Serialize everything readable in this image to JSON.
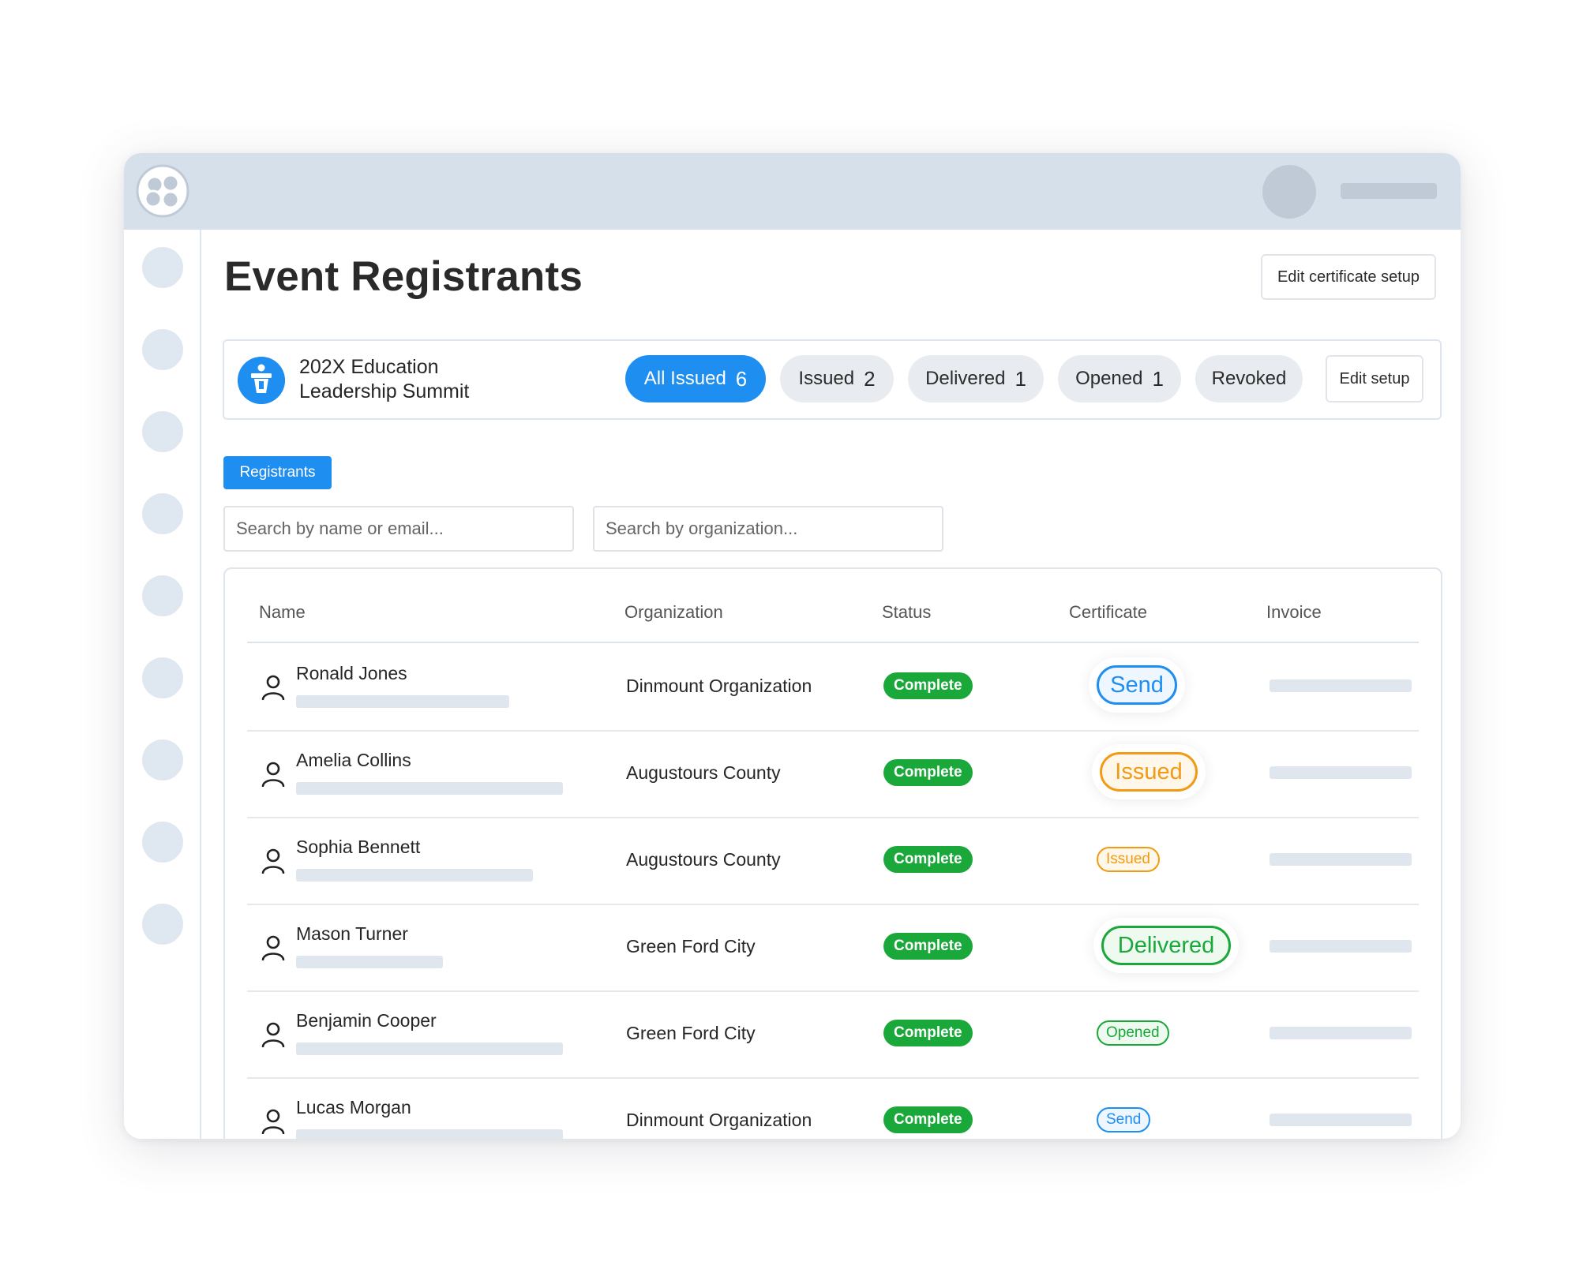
{
  "page": {
    "title": "Event Registrants",
    "edit_certificate_setup": "Edit certificate setup"
  },
  "event": {
    "name": "202X Education Leadership Summit",
    "filters": [
      {
        "label": "All Issued",
        "count": "6",
        "active": true
      },
      {
        "label": "Issued",
        "count": "2",
        "active": false
      },
      {
        "label": "Delivered",
        "count": "1",
        "active": false
      },
      {
        "label": "Opened",
        "count": "1",
        "active": false
      },
      {
        "label": "Revoked",
        "count": "",
        "active": false
      }
    ],
    "edit_setup": "Edit setup"
  },
  "tabs": {
    "registrants": "Registrants"
  },
  "search": {
    "name_placeholder": "Search by name or email...",
    "org_placeholder": "Search by organization..."
  },
  "table": {
    "columns": [
      "Name",
      "Organization",
      "Status",
      "Certificate",
      "Invoice"
    ],
    "rows": [
      {
        "name": "Ronald Jones",
        "organization": "Dinmount Organization",
        "status": "Complete",
        "certificate": "Send"
      },
      {
        "name": "Amelia Collins",
        "organization": "Augustours County",
        "status": "Complete",
        "certificate": "Issued"
      },
      {
        "name": "Sophia Bennett",
        "organization": "Augustours County",
        "status": "Complete",
        "certificate": "Issued"
      },
      {
        "name": "Mason Turner",
        "organization": "Green Ford City",
        "status": "Complete",
        "certificate": "Delivered"
      },
      {
        "name": "Benjamin Cooper",
        "organization": "Green Ford City",
        "status": "Complete",
        "certificate": "Opened"
      },
      {
        "name": "Lucas Morgan",
        "organization": "Dinmount Organization",
        "status": "Complete",
        "certificate": "Send"
      }
    ]
  },
  "colors": {
    "accent_blue": "#1f8ef1",
    "complete_green": "#1aa83b",
    "issued_orange": "#f29a13",
    "topbar": "#d6e0eb"
  }
}
